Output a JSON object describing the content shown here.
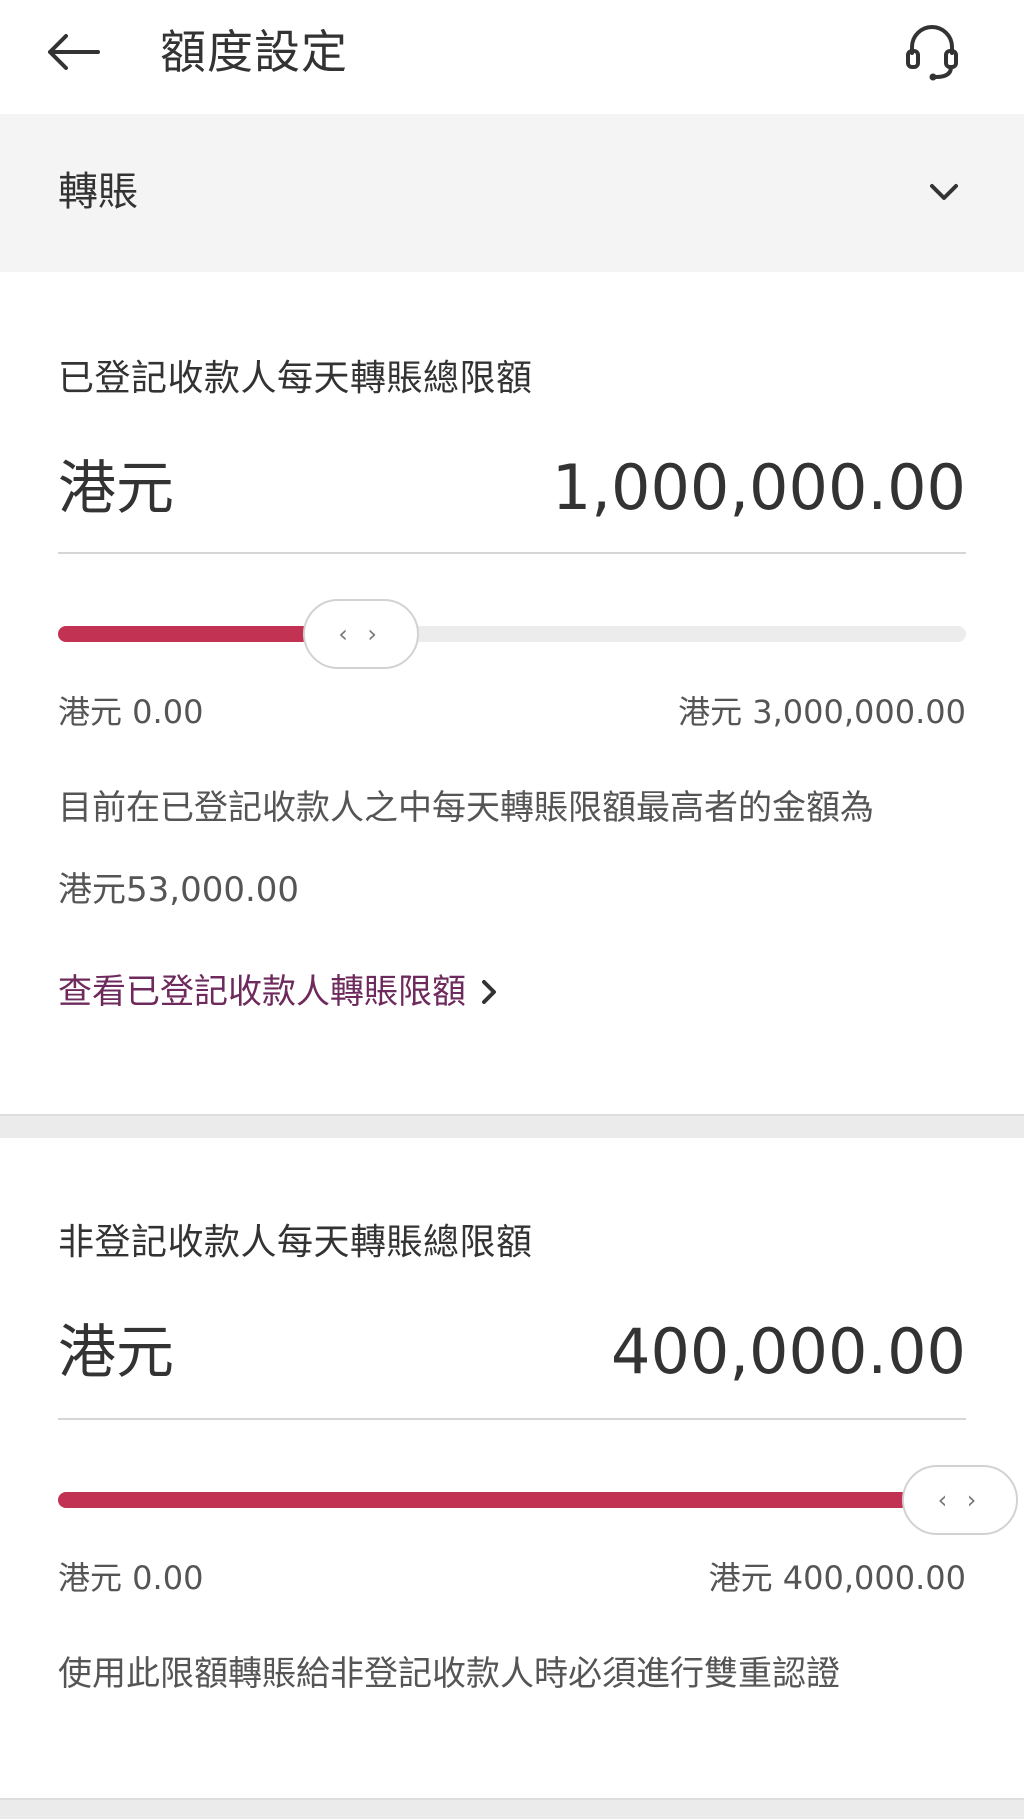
{
  "header": {
    "title": "額度設定",
    "back_icon": "arrow-left-icon",
    "support_icon": "headset-icon"
  },
  "category": {
    "selected": "轉賬",
    "icon": "chevron-down-icon"
  },
  "registered": {
    "title": "已登記收款人每天轉賬總限額",
    "currency": "港元",
    "amount": "1,000,000.00",
    "slider_fraction": 0.3333,
    "handle_glyph": "‹ ›",
    "min_label": "港元 0.00",
    "max_label": "港元 3,000,000.00",
    "note_line1": "目前在已登記收款人之中每天轉賬限額最高者的金額為",
    "note_line2": "港元53,000.00",
    "link_label": "查看已登記收款人轉賬限額"
  },
  "non_registered": {
    "title": "非登記收款人每天轉賬總限額",
    "currency": "港元",
    "amount": "400,000.00",
    "slider_fraction": 1.0,
    "handle_glyph": "‹ ›",
    "min_label": "港元 0.00",
    "max_label": "港元 400,000.00",
    "note": "使用此限額轉賬給非登記收款人時必須進行雙重認證"
  },
  "colors": {
    "accent": "#c23252",
    "link": "#6e2a5c",
    "track": "#ececec",
    "band": "#f4f4f4"
  }
}
